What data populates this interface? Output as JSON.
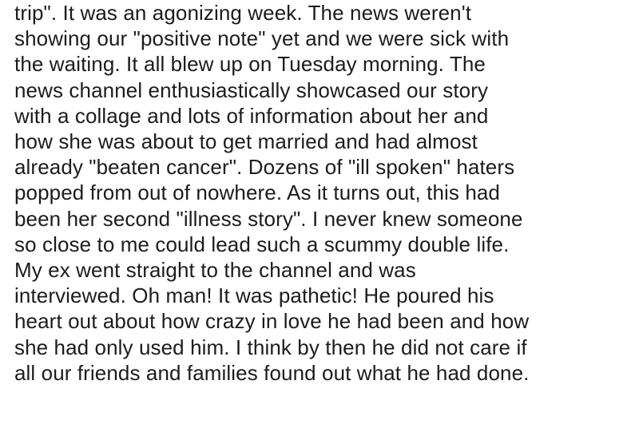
{
  "post": {
    "lines": [
      "trip\". It was an agonizing week. The news weren't",
      "showing our \"positive note\" yet and we were sick with",
      "the waiting. It all blew up on Tuesday morning. The",
      "news channel enthusiastically showcased our story",
      "with a collage and lots of information about her and",
      "how she was about to get married and had almost",
      "already \"beaten cancer\". Dozens of \"ill spoken\" haters",
      "popped from out of nowhere. As it turns out, this had",
      "been her second \"illness story\". I never knew someone",
      "so close to me could lead such a scummy double life.",
      "My ex went straight to the channel and was",
      "interviewed. Oh man! It was pathetic! He poured his",
      "heart out about how crazy in love he had been and how",
      "she had only used him. I think by then he did not care if",
      "all our friends and families found out what he had done."
    ]
  }
}
